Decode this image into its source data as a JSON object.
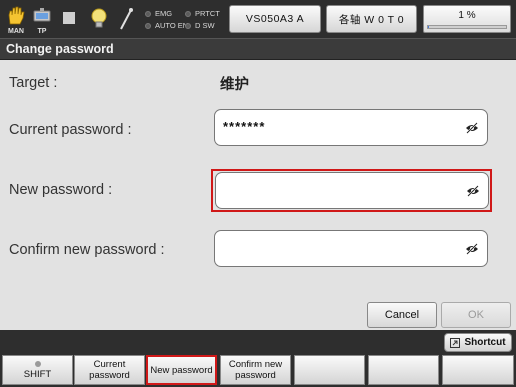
{
  "topbar": {
    "man_label": "MAN",
    "tp_label": "TP",
    "leds": [
      {
        "label": "EMG"
      },
      {
        "label": "AUTO EN"
      },
      {
        "label": "PRTCT"
      },
      {
        "label": "D SW"
      }
    ],
    "robot_button": "VS050A3 A",
    "axis_button": "各轴 W 0 T 0",
    "speed": {
      "label": "1 %",
      "value": 1
    }
  },
  "title": "Change password",
  "form": {
    "target_label": "Target :",
    "target_value": "维护",
    "current_label": "Current password :",
    "current_value": "*******",
    "new_label": "New password :",
    "new_value": "",
    "confirm_label": "Confirm new password :",
    "confirm_value": "",
    "eye_icon": "eye-slash-icon"
  },
  "buttons": {
    "cancel": "Cancel",
    "ok": "OK"
  },
  "shortcut": "Shortcut",
  "fkeys": [
    {
      "line1": "",
      "line2": "SHIFT"
    },
    {
      "line1": "Current",
      "line2": "password"
    },
    {
      "line1": "New password",
      "line2": ""
    },
    {
      "line1": "Confirm new",
      "line2": "password"
    },
    {
      "line1": "",
      "line2": ""
    },
    {
      "line1": "",
      "line2": ""
    },
    {
      "line1": "",
      "line2": ""
    }
  ],
  "colors": {
    "highlight": "#d01818",
    "progress": "#4b7bd8"
  }
}
